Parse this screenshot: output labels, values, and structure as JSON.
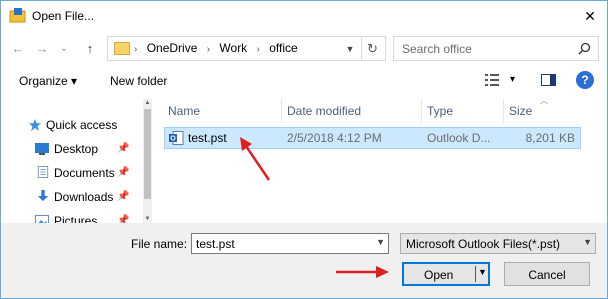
{
  "window": {
    "title": "Open File...",
    "close_glyph": "✕"
  },
  "nav_buttons": {
    "back": "←",
    "forward": "→",
    "recent": "⌄",
    "up": "↑"
  },
  "address": {
    "crumbs": [
      "OneDrive",
      "Work",
      "office"
    ],
    "separator": "›"
  },
  "search": {
    "placeholder": "Search office"
  },
  "toolbar": {
    "organize": "Organize ▾",
    "new_folder": "New folder",
    "view_arrow": "▾",
    "help": "?"
  },
  "nav_pane": {
    "items": [
      {
        "label": "Quick access",
        "icon": "star-icon"
      },
      {
        "label": "Desktop",
        "icon": "desktop-icon",
        "pinned": true
      },
      {
        "label": "Documents",
        "icon": "documents-icon",
        "pinned": true
      },
      {
        "label": "Downloads",
        "icon": "downloads-icon",
        "pinned": true
      },
      {
        "label": "Pictures",
        "icon": "pictures-icon",
        "pinned": true
      }
    ],
    "pin_glyph": "📌"
  },
  "file_list": {
    "columns": {
      "name": "Name",
      "date": "Date modified",
      "type": "Type",
      "size": "Size"
    },
    "rows": [
      {
        "name": "test.pst",
        "date": "2/5/2018 4:12 PM",
        "type": "Outlook D...",
        "size": "8,201 KB",
        "selected": true
      }
    ]
  },
  "footer": {
    "file_name_label": "File name:",
    "file_name_value": "test.pst",
    "file_type_value": "Microsoft Outlook Files(*.pst)",
    "open_label": "Open",
    "cancel_label": "Cancel"
  },
  "colors": {
    "accent": "#0078d7",
    "selection_bg": "#cce8ff",
    "annotation_arrow": "#e02020"
  }
}
